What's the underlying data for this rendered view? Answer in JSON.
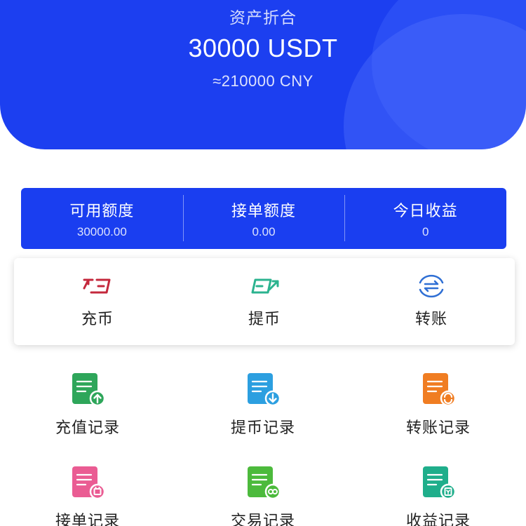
{
  "header": {
    "label": "资产折合",
    "amount": "30000 USDT",
    "cny": "≈210000 CNY"
  },
  "stats": [
    {
      "label": "可用额度",
      "value": "30000.00"
    },
    {
      "label": "接单额度",
      "value": "0.00"
    },
    {
      "label": "今日收益",
      "value": "0"
    }
  ],
  "actions": [
    {
      "label": "充币",
      "icon": "deposit-icon",
      "color": "#c4283c"
    },
    {
      "label": "提币",
      "icon": "withdraw-icon",
      "color": "#2bb38f"
    },
    {
      "label": "转账",
      "icon": "transfer-icon",
      "color": "#2f6fd4"
    }
  ],
  "records": [
    {
      "label": "充值记录",
      "icon": "recharge-record-icon",
      "color": "#2ea65a"
    },
    {
      "label": "提币记录",
      "icon": "withdraw-record-icon",
      "color": "#2c9fe0"
    },
    {
      "label": "转账记录",
      "icon": "transfer-record-icon",
      "color": "#f07d22"
    },
    {
      "label": "接单记录",
      "icon": "order-record-icon",
      "color": "#ea5c93"
    },
    {
      "label": "交易记录",
      "icon": "trade-record-icon",
      "color": "#4cba3c"
    },
    {
      "label": "收益记录",
      "icon": "earnings-record-icon",
      "color": "#1fae8b"
    }
  ]
}
